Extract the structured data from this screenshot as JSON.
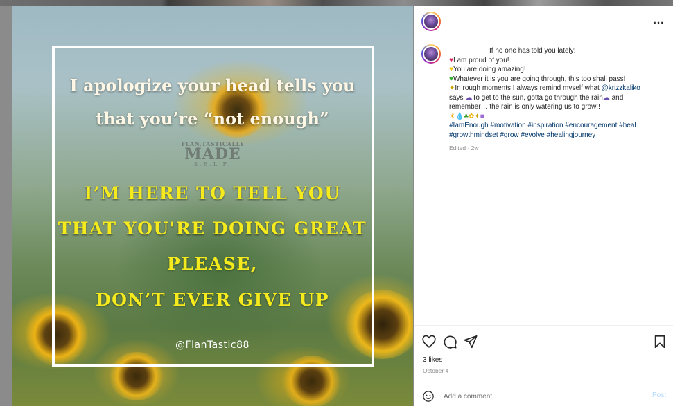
{
  "image": {
    "line1": "I apologize your head tells you",
    "line2": "that you’re “not enough”",
    "watermark": {
      "top": "FLAN.TASTICALLY",
      "mid": "MADE",
      "bot": "S.E.L.F."
    },
    "yellow_lines": [
      "I’M HERE TO TELL YOU",
      "THAT YOU'RE DOING GREAT",
      "PLEASE,",
      "DON’T EVER GIVE UP"
    ],
    "handle": "@FlanTastic88"
  },
  "header": {
    "more_icon": "⋯"
  },
  "caption": {
    "first": "If no one has told you lately:",
    "l2": "I am proud of you!",
    "l3": "You are doing amazing!",
    "l4": "Whatever it is you are going through, this too shall pass!",
    "l5a": "In rough moments I always remind myself what ",
    "l5_mention": "@krizzkaliko",
    "l6": "says ",
    "l6b": "To get to the sun, gotta go through the rain",
    "l6c": " and",
    "l7": "remember… the rain is only watering us to grow!!",
    "tags1": "#IamEnough #motivation #inspiration #encouragement #heal",
    "tags2": "#growthmindset #grow #evolve #healingjourney"
  },
  "edited": "Edited · 2w",
  "likes": "3 likes",
  "date": "October 4",
  "comment": {
    "placeholder": "Add a comment…",
    "post_label": "Post"
  },
  "colors": {
    "link": "#00376b",
    "post_disabled": "#b3dbff",
    "yellow_text": "#f4ea1e"
  }
}
